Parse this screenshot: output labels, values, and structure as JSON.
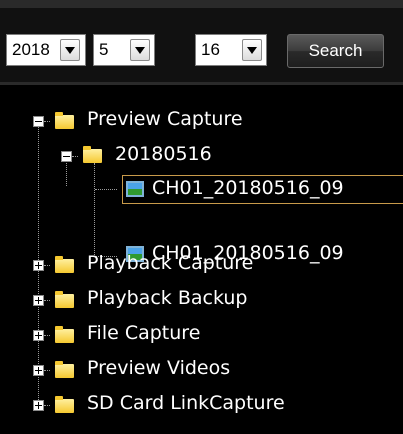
{
  "search_bar": {
    "year": "2018",
    "month": "5",
    "day": "16",
    "search_label": "Search"
  },
  "tree": {
    "preview_capture": {
      "label": "Preview Capture",
      "date_folder": "20180516",
      "files": [
        "CH01_20180516_09",
        "CH01_20180516_09"
      ]
    },
    "others": [
      {
        "label": "Playback Capture"
      },
      {
        "label": "Playback Backup"
      },
      {
        "label": "File Capture"
      },
      {
        "label": "Preview Videos"
      },
      {
        "label": "SD Card LinkCapture"
      }
    ]
  },
  "colors": {
    "background": "#000000",
    "text": "#ffffff",
    "folder": "#f5c830",
    "selection_border": "#c89a4a"
  }
}
